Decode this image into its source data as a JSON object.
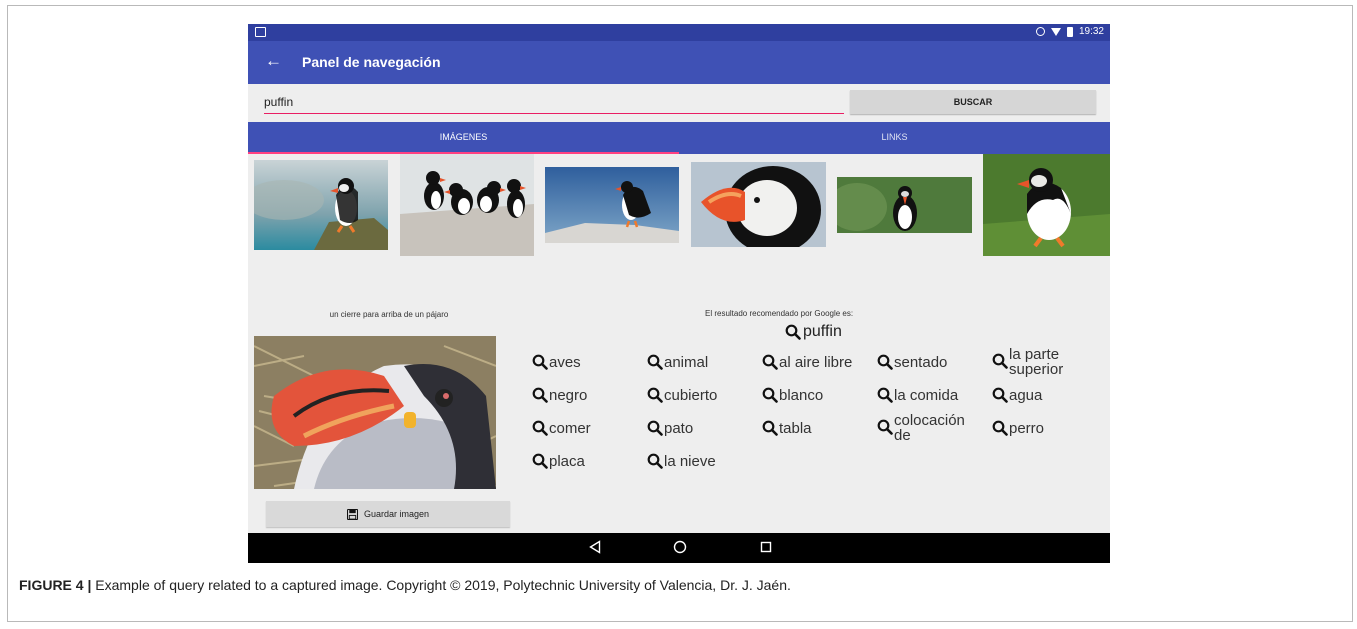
{
  "statusbar": {
    "time": "19:32",
    "icons": [
      "sync-icon",
      "wifi-icon",
      "battery-icon"
    ]
  },
  "appbar": {
    "title": "Panel de navegación",
    "back_icon": "arrow-back-icon"
  },
  "search": {
    "value": "puffin",
    "button_label": "BUSCAR"
  },
  "tabs": [
    {
      "label": "IMÁGENES",
      "active": true
    },
    {
      "label": "LINKS",
      "active": false
    }
  ],
  "captured": {
    "caption": "un cierre para arriba de un pájaro",
    "save_label": "Guardar imagen"
  },
  "recommendation": {
    "label": "El resultado recomendado por Google es:",
    "term": "puffin"
  },
  "tags": [
    "aves",
    "animal",
    "al aire libre",
    "sentado",
    "la parte\nsuperior",
    "negro",
    "cubierto",
    "blanco",
    "la comida",
    "agua",
    "comer",
    "pato",
    "tabla",
    "colocación\nde",
    "perro",
    "placa",
    "la nieve"
  ],
  "navbar": {
    "icons": [
      "back-triangle-icon",
      "home-circle-icon",
      "recents-square-icon"
    ]
  },
  "figure_caption": {
    "label": "FIGURE 4 |",
    "text": " Example of query related to a captured image. Copyright © 2019, Polytechnic University of Valencia, Dr. J. Jaén."
  },
  "colors": {
    "primary": "#3f51b5",
    "primary_dark": "#2f3f9f",
    "accent": "#ff4081",
    "background": "#eeeeee"
  }
}
